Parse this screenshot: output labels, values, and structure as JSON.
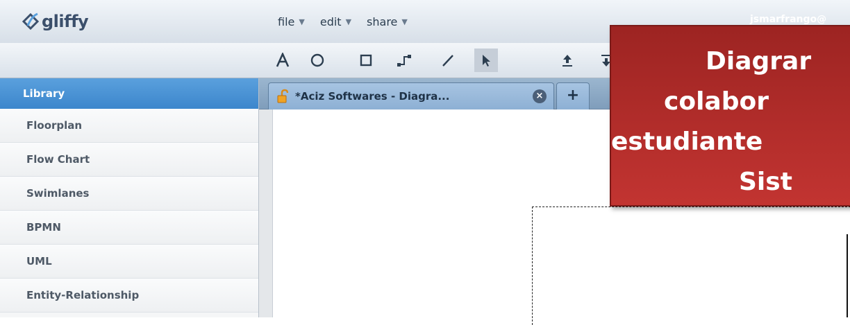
{
  "app": {
    "logo_text": "gliffy",
    "user": "jsmarfrango@"
  },
  "menu": [
    {
      "label": "file"
    },
    {
      "label": "edit"
    },
    {
      "label": "share"
    }
  ],
  "toolbar": {
    "tools": [
      {
        "name": "text-tool",
        "icon": "A"
      },
      {
        "name": "ellipse-tool",
        "icon": "circle"
      },
      {
        "name": "rectangle-tool",
        "icon": "square"
      },
      {
        "name": "connector-tool",
        "icon": "elbow-line"
      },
      {
        "name": "line-tool",
        "icon": "diagonal-line"
      },
      {
        "name": "pointer-tool",
        "icon": "arrow-cursor"
      },
      {
        "name": "upload-tool",
        "icon": "upload-arrow"
      },
      {
        "name": "download-tool",
        "icon": "download-arrow"
      }
    ]
  },
  "sidebar": {
    "header": "Library",
    "items": [
      {
        "label": "Floorplan"
      },
      {
        "label": "Flow Chart"
      },
      {
        "label": "Swimlanes"
      },
      {
        "label": "BPMN"
      },
      {
        "label": "UML"
      },
      {
        "label": "Entity-Relationship"
      }
    ]
  },
  "tabs": {
    "active_label": "*Aciz Softwares - Diagra...",
    "add_label": "+"
  },
  "callout": {
    "lines": [
      "Diagrar",
      "colabor",
      "estudiante",
      "Sist"
    ],
    "color": "#b02c2a"
  }
}
